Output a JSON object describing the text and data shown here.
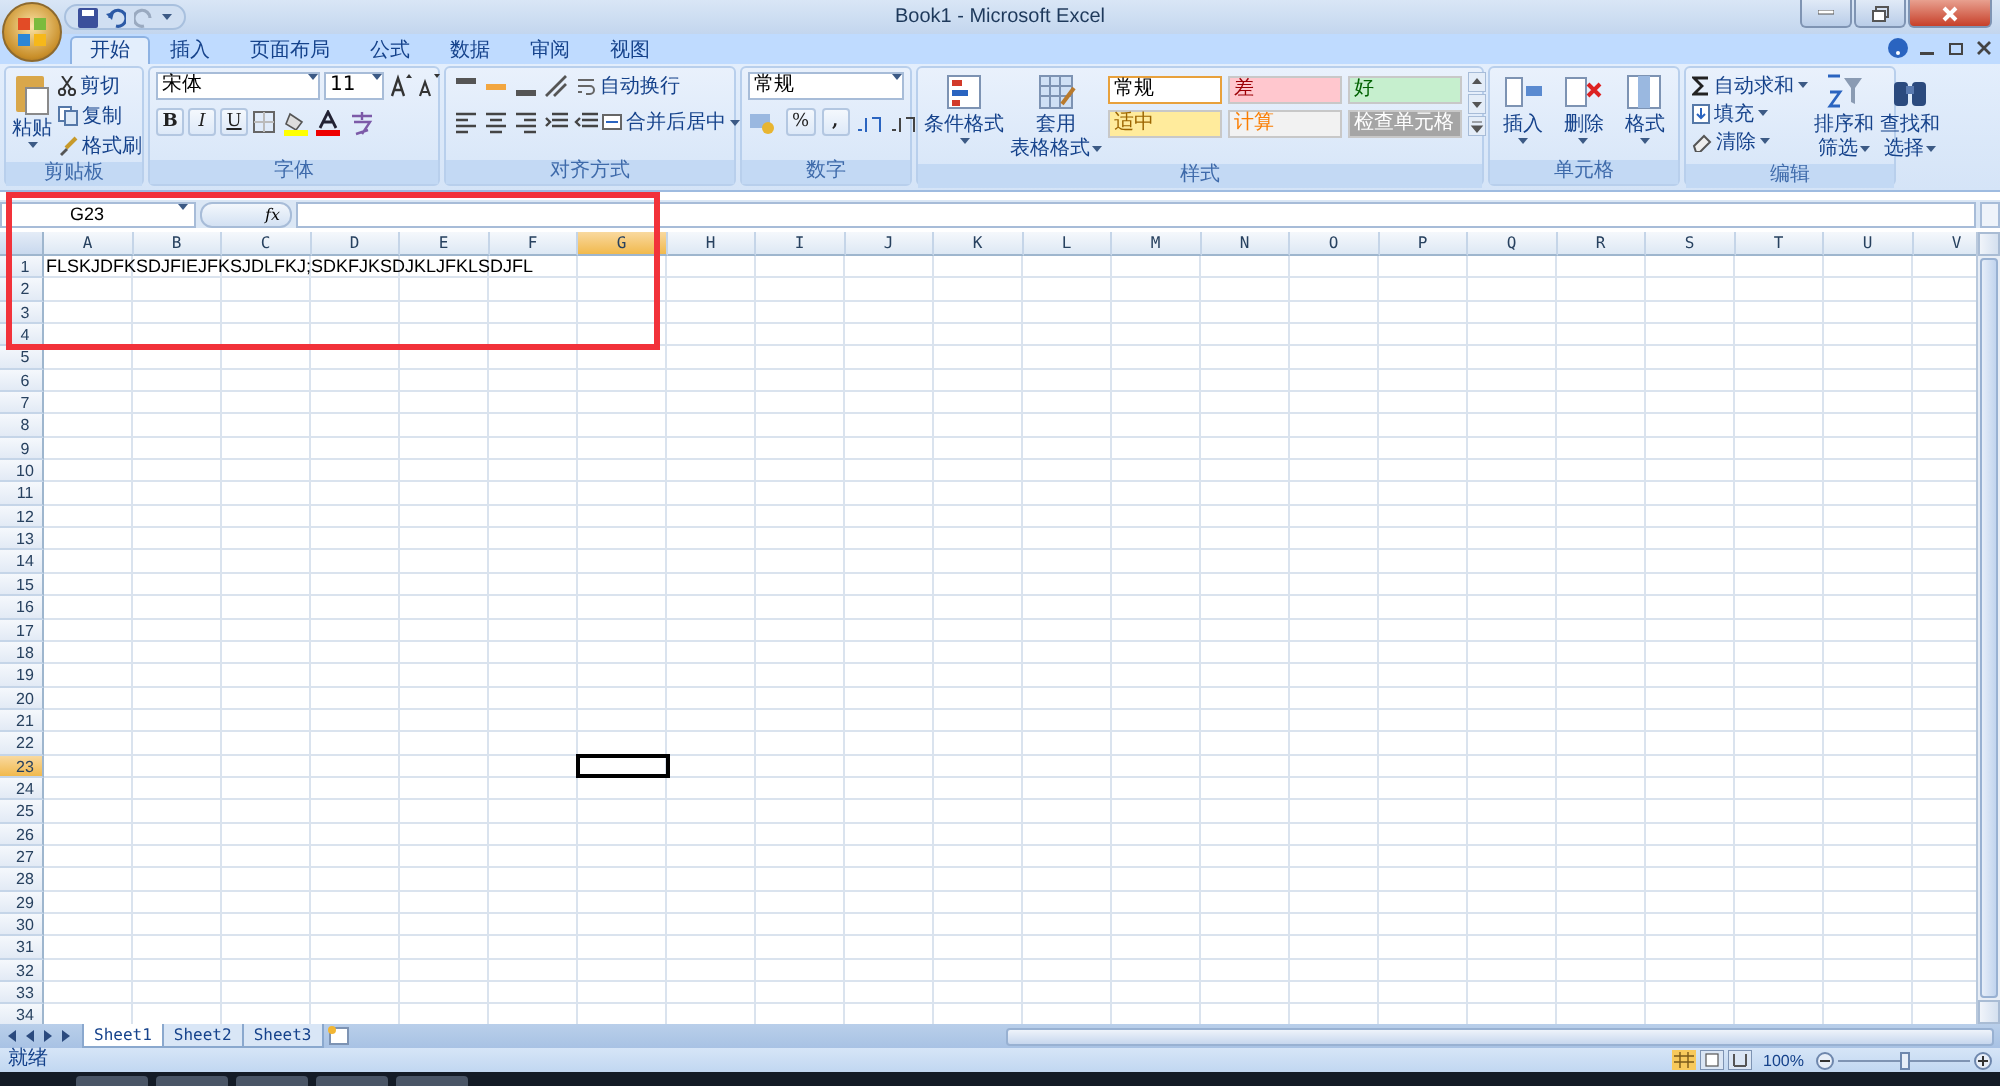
{
  "window": {
    "title": "Book1 - Microsoft Excel"
  },
  "tabs": [
    {
      "label": "开始",
      "selected": true
    },
    {
      "label": "插入",
      "selected": false
    },
    {
      "label": "页面布局",
      "selected": false
    },
    {
      "label": "公式",
      "selected": false
    },
    {
      "label": "数据",
      "selected": false
    },
    {
      "label": "审阅",
      "selected": false
    },
    {
      "label": "视图",
      "selected": false
    }
  ],
  "clipboard": {
    "paste": "粘贴",
    "cut": "剪切",
    "copy": "复制",
    "format_painter": "格式刷",
    "label": "剪贴板"
  },
  "font": {
    "font_name": "宋体",
    "font_size": "11",
    "bold": "B",
    "italic": "I",
    "underline": "U",
    "label": "字体"
  },
  "alignment": {
    "wrap": "自动换行",
    "merge": "合并后居中",
    "label": "对齐方式"
  },
  "number": {
    "format": "常规",
    "percent": "%",
    "comma": ",",
    "label": "数字"
  },
  "styles": {
    "conditional": "条件格式",
    "table_lines": [
      "套用",
      "表格格式"
    ],
    "label": "样式",
    "cell_styles": [
      {
        "label": "常规",
        "color": "#ffffff",
        "kind": "normal",
        "selected": true
      },
      {
        "label": "差",
        "color": "#ffc7ce",
        "kind": "bad",
        "selected": false
      },
      {
        "label": "好",
        "color": "#c6efce",
        "kind": "good",
        "selected": false
      },
      {
        "label": "适中",
        "color": "#ffeb9c",
        "kind": "neutral",
        "selected": false
      },
      {
        "label": "计算",
        "color": "#f2f2f2",
        "kind": "calculation",
        "selected": false
      },
      {
        "label": "检查单元格",
        "color": "#a5a5a5",
        "kind": "check",
        "selected": false
      }
    ]
  },
  "cells": {
    "insert": "插入",
    "delete": "删除",
    "format": "格式",
    "label": "单元格"
  },
  "editing": {
    "autosum": "自动求和",
    "fill": "填充",
    "clear": "清除",
    "sort_lines": [
      "排序和",
      "筛选"
    ],
    "find_lines": [
      "查找和",
      "选择"
    ],
    "label": "编辑"
  },
  "formula_bar": {
    "name_box": "G23",
    "fx": "fx"
  },
  "columns": [
    {
      "label": "A",
      "selected": false
    },
    {
      "label": "B",
      "selected": false
    },
    {
      "label": "C",
      "selected": false
    },
    {
      "label": "D",
      "selected": false
    },
    {
      "label": "E",
      "selected": false
    },
    {
      "label": "F",
      "selected": false
    },
    {
      "label": "G",
      "selected": true
    },
    {
      "label": "H",
      "selected": false
    },
    {
      "label": "I",
      "selected": false
    },
    {
      "label": "J",
      "selected": false
    },
    {
      "label": "K",
      "selected": false
    },
    {
      "label": "L",
      "selected": false
    },
    {
      "label": "M",
      "selected": false
    },
    {
      "label": "N",
      "selected": false
    },
    {
      "label": "O",
      "selected": false
    },
    {
      "label": "P",
      "selected": false
    },
    {
      "label": "Q",
      "selected": false
    },
    {
      "label": "R",
      "selected": false
    },
    {
      "label": "S",
      "selected": false
    },
    {
      "label": "T",
      "selected": false
    },
    {
      "label": "U",
      "selected": false
    },
    {
      "label": "V",
      "selected": false
    }
  ],
  "rows": [
    {
      "label": "1",
      "selected": false,
      "cells": [
        "FLSKJDFKSDJFIEJFKSJDLFKJ;SDKFJKSDJKLJFKLSDJFL"
      ]
    },
    {
      "label": "2",
      "selected": false
    },
    {
      "label": "3",
      "selected": false
    },
    {
      "label": "4",
      "selected": false
    },
    {
      "label": "5",
      "selected": false
    },
    {
      "label": "6",
      "selected": false
    },
    {
      "label": "7",
      "selected": false
    },
    {
      "label": "8",
      "selected": false
    },
    {
      "label": "9",
      "selected": false
    },
    {
      "label": "10",
      "selected": false
    },
    {
      "label": "11",
      "selected": false
    },
    {
      "label": "12",
      "selected": false
    },
    {
      "label": "13",
      "selected": false
    },
    {
      "label": "14",
      "selected": false
    },
    {
      "label": "15",
      "selected": false
    },
    {
      "label": "16",
      "selected": false
    },
    {
      "label": "17",
      "selected": false
    },
    {
      "label": "18",
      "selected": false
    },
    {
      "label": "19",
      "selected": false
    },
    {
      "label": "20",
      "selected": false
    },
    {
      "label": "21",
      "selected": false
    },
    {
      "label": "22",
      "selected": false
    },
    {
      "label": "23",
      "selected": true
    },
    {
      "label": "24",
      "selected": false
    },
    {
      "label": "25",
      "selected": false
    },
    {
      "label": "26",
      "selected": false
    },
    {
      "label": "27",
      "selected": false
    },
    {
      "label": "28",
      "selected": false
    },
    {
      "label": "29",
      "selected": false
    },
    {
      "label": "30",
      "selected": false
    },
    {
      "label": "31",
      "selected": false
    },
    {
      "label": "32",
      "selected": false
    },
    {
      "label": "33",
      "selected": false
    },
    {
      "label": "34",
      "selected": false
    }
  ],
  "sheets": [
    {
      "label": "Sheet1",
      "selected": true
    },
    {
      "label": "Sheet2",
      "selected": false
    },
    {
      "label": "Sheet3",
      "selected": false
    }
  ],
  "status_bar": {
    "status": "就绪",
    "zoom": "100%",
    "zoom_slider": {
      "level": 0.5
    }
  }
}
